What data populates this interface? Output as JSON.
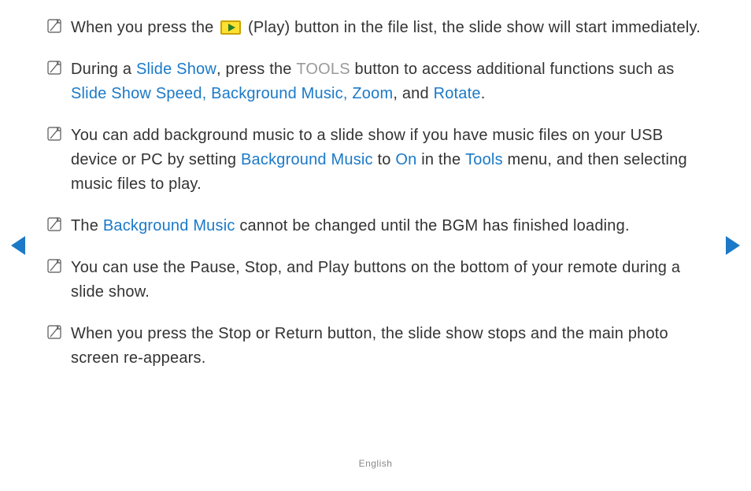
{
  "notes": [
    {
      "segments": [
        {
          "text": "When you press the "
        },
        {
          "play_icon": true
        },
        {
          "text": " (Play) button in the file list, the slide show will start immediately."
        }
      ]
    },
    {
      "segments": [
        {
          "text": "During a "
        },
        {
          "text": "Slide Show",
          "class": "blue"
        },
        {
          "text": ", press the "
        },
        {
          "text": "TOOLS",
          "class": "tools"
        },
        {
          "text": " button to access additional functions such as "
        },
        {
          "text": "Slide Show Speed, Background Music, Zoom",
          "class": "blue"
        },
        {
          "text": ", and "
        },
        {
          "text": "Rotate",
          "class": "blue"
        },
        {
          "text": "."
        }
      ]
    },
    {
      "segments": [
        {
          "text": "You can add background music to a slide show if you have music files on your USB device or PC by setting "
        },
        {
          "text": "Background Music",
          "class": "blue"
        },
        {
          "text": " to "
        },
        {
          "text": "On",
          "class": "blue"
        },
        {
          "text": " in the "
        },
        {
          "text": "Tools",
          "class": "blue"
        },
        {
          "text": " menu, and then selecting music files to play."
        }
      ]
    },
    {
      "segments": [
        {
          "text": "The "
        },
        {
          "text": "Background Music",
          "class": "blue"
        },
        {
          "text": " cannot be changed until the BGM has finished loading."
        }
      ]
    },
    {
      "segments": [
        {
          "text": "You can use the Pause, Stop, and Play buttons on the bottom of your remote during a slide show."
        }
      ]
    },
    {
      "segments": [
        {
          "text": "When you press the Stop or Return button, the slide show stops and the main photo screen re-appears."
        }
      ]
    }
  ],
  "footer": "English"
}
